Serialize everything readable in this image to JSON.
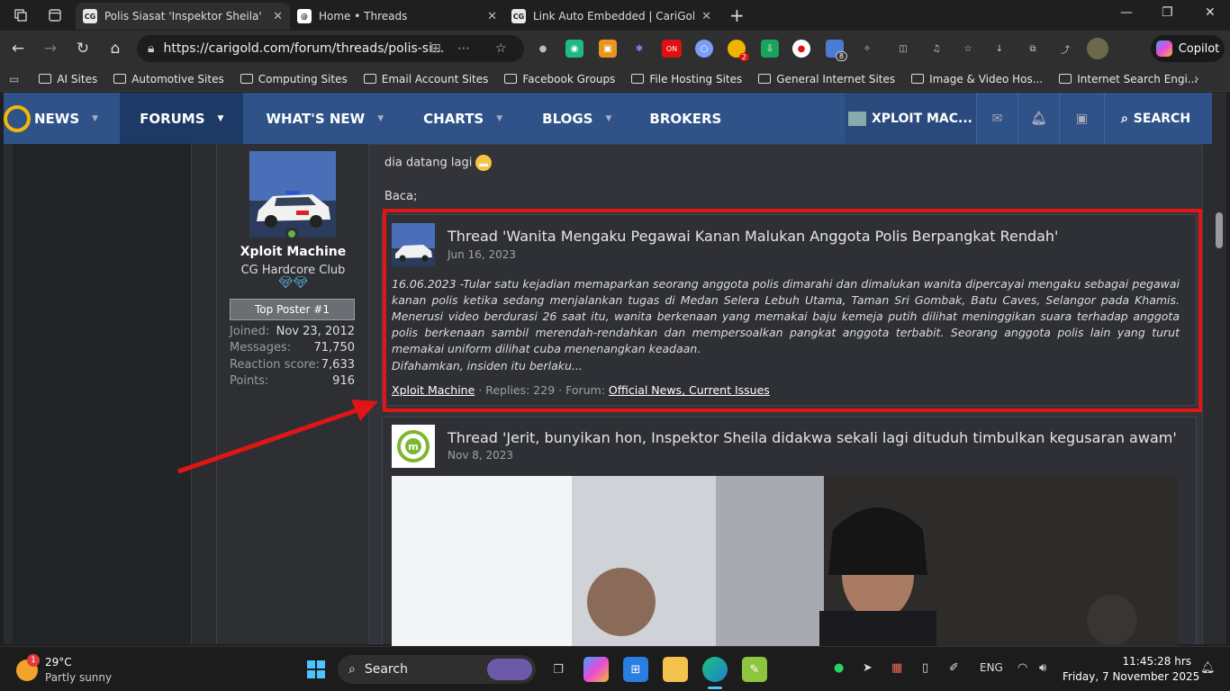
{
  "tabs": [
    {
      "title": "Polis Siasat 'Inspektor Sheila' Pert",
      "favicon": "CG",
      "active": true
    },
    {
      "title": "Home • Threads",
      "favicon": "@",
      "active": false
    },
    {
      "title": "Link Auto Embedded | CariGold Fo",
      "favicon": "CG",
      "active": false
    }
  ],
  "address": {
    "url": "https://carigold.com/forum/threads/polis-si..."
  },
  "extension_badges": {
    "on": "ON",
    "count1": "2",
    "count2": "8"
  },
  "copilot_label": "Copilot",
  "bookmarks": [
    "AI Sites",
    "Automotive Sites",
    "Computing Sites",
    "Email Account Sites",
    "Facebook Groups",
    "File Hosting Sites",
    "General Internet Sites",
    "Image & Video Hos...",
    "Internet Search Engi..."
  ],
  "nav": {
    "items": [
      "NEWS",
      "FORUMS",
      "WHAT'S NEW",
      "CHARTS",
      "BLOGS",
      "BROKERS"
    ],
    "user": "XPLOIT MAC...",
    "search": "SEARCH"
  },
  "user": {
    "name": "Xploit Machine",
    "title": "CG Hardcore Club",
    "badge": "Top Poster #1",
    "stats": [
      {
        "k": "Joined:",
        "v": "Nov 23, 2012"
      },
      {
        "k": "Messages:",
        "v": "71,750"
      },
      {
        "k": "Reaction score:",
        "v": "7,633"
      },
      {
        "k": "Points:",
        "v": "916"
      }
    ]
  },
  "post": {
    "line1": "dia datang lagi",
    "line2": "Baca;"
  },
  "embed1": {
    "title": "Thread 'Wanita Mengaku Pegawai Kanan Malukan Anggota Polis Berpangkat Rendah'",
    "date": "Jun 16, 2023",
    "text": "16.06.2023 -Tular satu kejadian memaparkan seorang anggota polis dimarahi dan dimalukan wanita dipercayai mengaku sebagai pegawai kanan polis ketika sedang menjalankan tugas di Medan Selera Lebuh Utama, Taman Sri Gombak, Batu Caves, Selangor pada Khamis. Menerusi video berdurasi 26 saat itu, wanita berkenaan yang memakai baju kemeja putih dilihat meninggikan suara terhadap anggota polis berkenaan sambil merendah-rendahkan dan mempersoalkan pangkat anggota terbabit. Seorang anggota polis lain yang turut memakai uniform dilihat cuba menenangkan keadaan.",
    "more": "Difahamkan, insiden itu berlaku...",
    "author": "Xploit Machine",
    "replies": "· Replies: 229 · Forum:",
    "forum": "Official News, Current Issues"
  },
  "embed2": {
    "title": "Thread 'Jerit, bunyikan hon, Inspektor Sheila didakwa sekali lagi dituduh timbulkan kegusaran awam'",
    "date": "Nov 8, 2023"
  },
  "taskbar": {
    "temp": "29°C",
    "weather": "Partly sunny",
    "weather_badge": "1",
    "search": "Search",
    "lang": "ENG",
    "time": "11:45:28 hrs",
    "date": "Friday, 7 November 2025"
  }
}
